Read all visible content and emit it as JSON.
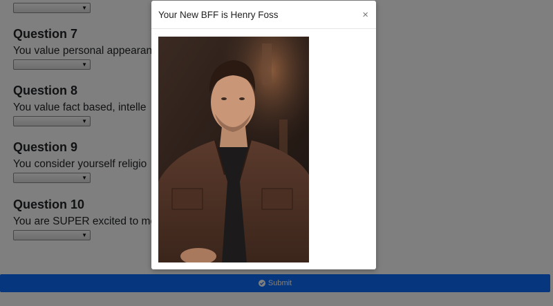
{
  "questions": [
    {
      "title": "Question 7",
      "text": "You value personal appearan"
    },
    {
      "title": "Question 8",
      "text": "You value fact based, intelle"
    },
    {
      "title": "Question 9",
      "text": "You consider yourself religio"
    },
    {
      "title": "Question 10",
      "text": "You are SUPER excited to me"
    }
  ],
  "submit": {
    "label": "Submit",
    "icon": "check-circle-icon"
  },
  "modal": {
    "title": "Your New BFF is Henry Foss",
    "close_label": "×",
    "image_subject": "Henry Foss"
  },
  "colors": {
    "submit_bg": "#0d6efd",
    "backdrop": "rgba(0,0,0,0.5)"
  }
}
